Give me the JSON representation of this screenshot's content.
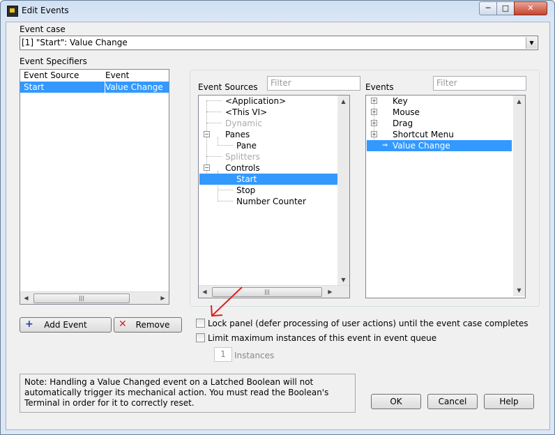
{
  "window": {
    "title": "Edit Events"
  },
  "event_case": {
    "label": "Event case",
    "value": "[1] \"Start\": Value Change"
  },
  "event_specifiers": {
    "label": "Event Specifiers",
    "col_source": "Event Source",
    "col_event": "Event",
    "rows": [
      {
        "source": "Start",
        "event": "Value Change"
      }
    ]
  },
  "event_sources": {
    "label": "Event Sources",
    "filter_placeholder": "Filter",
    "items": [
      "<Application>",
      "<This VI>",
      "Dynamic",
      "Panes",
      "Pane",
      "Splitters",
      "Controls",
      "Start",
      "Stop",
      "Number Counter"
    ]
  },
  "events": {
    "label": "Events",
    "filter_placeholder": "Filter",
    "items": [
      "Key",
      "Mouse",
      "Drag",
      "Shortcut Menu",
      "Value Change"
    ]
  },
  "buttons": {
    "add_event": "Add Event",
    "remove": "Remove",
    "ok": "OK",
    "cancel": "Cancel",
    "help": "Help"
  },
  "options": {
    "lock_panel": "Lock panel (defer processing of user actions) until the event case completes",
    "limit_instances": "Limit maximum instances of this event in event queue",
    "instances_value": "1",
    "instances_label": "Instances"
  },
  "note": "Note:  Handling a Value Changed event on a Latched Boolean will not automatically trigger its mechanical action. You must read the Boolean's Terminal in order for it to correctly reset.",
  "colors": {
    "selection": "#3399ff",
    "annotation_arrow": "#e02020"
  }
}
